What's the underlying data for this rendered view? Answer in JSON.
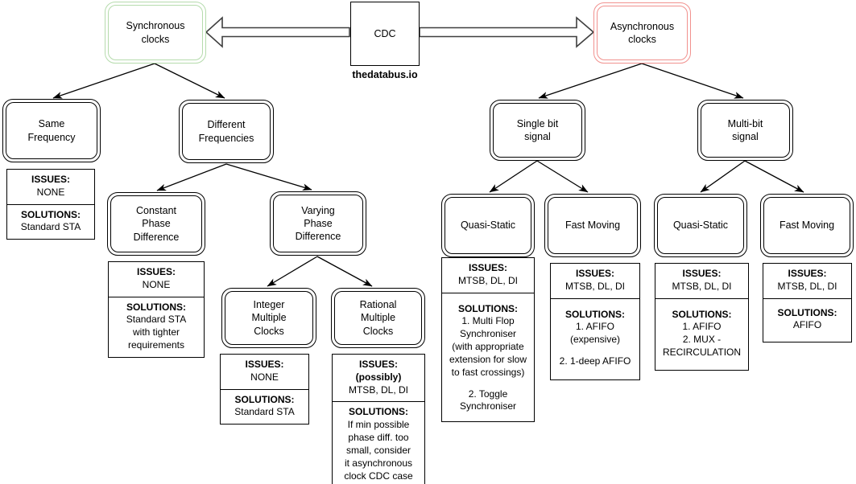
{
  "title": "CDC classification tree",
  "watermark": "thedatabus.io",
  "colors": {
    "synchronous_accent": "#b5dbac",
    "asynchronous_accent": "#f1918e",
    "stroke": "#000000"
  },
  "root": {
    "label": "CDC"
  },
  "branches": {
    "synchronous": {
      "label": "Synchronous\nclocks",
      "line1": "Synchronous",
      "line2": "clocks"
    },
    "asynchronous": {
      "label": "Asynchronous\nclocks",
      "line1": "Asynchronous",
      "line2": "clocks"
    }
  },
  "nodes": {
    "same_frequency": {
      "line1": "Same",
      "line2": "Frequency"
    },
    "different_frequencies": {
      "line1": "Different",
      "line2": "Frequencies"
    },
    "constant_phase": {
      "line1": "Constant",
      "line2": "Phase",
      "line3": "Difference"
    },
    "varying_phase": {
      "line1": "Varying",
      "line2": "Phase",
      "line3": "Difference"
    },
    "integer_multiple": {
      "line1": "Integer",
      "line2": "Multiple",
      "line3": "Clocks"
    },
    "rational_multiple": {
      "line1": "Rational",
      "line2": "Multiple",
      "line3": "Clocks"
    },
    "single_bit": {
      "line1": "Single bit",
      "line2": "signal"
    },
    "multi_bit": {
      "line1": "Multi-bit",
      "line2": "signal"
    },
    "sb_quasi_static": {
      "line1": "Quasi-Static"
    },
    "sb_fast_moving": {
      "line1": "Fast Moving"
    },
    "mb_quasi_static": {
      "line1": "Quasi-Static"
    },
    "mb_fast_moving": {
      "line1": "Fast Moving"
    }
  },
  "labels": {
    "issues": "ISSUES:",
    "solutions": "SOLUTIONS:"
  },
  "cards": {
    "same_frequency": {
      "issues": "NONE",
      "solutions": "Standard STA"
    },
    "constant_phase": {
      "issues": "NONE",
      "solutions_l1": "Standard STA",
      "solutions_l2": "with tighter",
      "solutions_l3": "requirements"
    },
    "integer_multiple": {
      "issues": "NONE",
      "solutions": "Standard STA"
    },
    "rational_multiple": {
      "issues_sub": "(possibly)",
      "issues": "MTSB, DL, DI",
      "solutions_l1": "If min possible",
      "solutions_l2": "phase diff. too",
      "solutions_l3": "small, consider",
      "solutions_l4": "it asynchronous",
      "solutions_l5": "clock CDC case"
    },
    "sb_quasi_static": {
      "issues": "MTSB, DL, DI",
      "solutions_l1": "1. Multi Flop",
      "solutions_l2": "Synchroniser",
      "solutions_l3": "(with appropriate",
      "solutions_l4": "extension for slow",
      "solutions_l5": "to fast crossings)",
      "solutions_l6": "2. Toggle",
      "solutions_l7": "Synchroniser"
    },
    "sb_fast_moving": {
      "issues": "MTSB, DL, DI",
      "solutions_l1": "1. AFIFO",
      "solutions_l2": "(expensive)",
      "solutions_l3": "2. 1-deep AFIFO"
    },
    "mb_quasi_static": {
      "issues": "MTSB, DL, DI",
      "solutions_l1": "1. AFIFO",
      "solutions_l2": "2. MUX -",
      "solutions_l3": "RECIRCULATION"
    },
    "mb_fast_moving": {
      "issues": "MTSB, DL, DI",
      "solutions": "AFIFO"
    }
  }
}
